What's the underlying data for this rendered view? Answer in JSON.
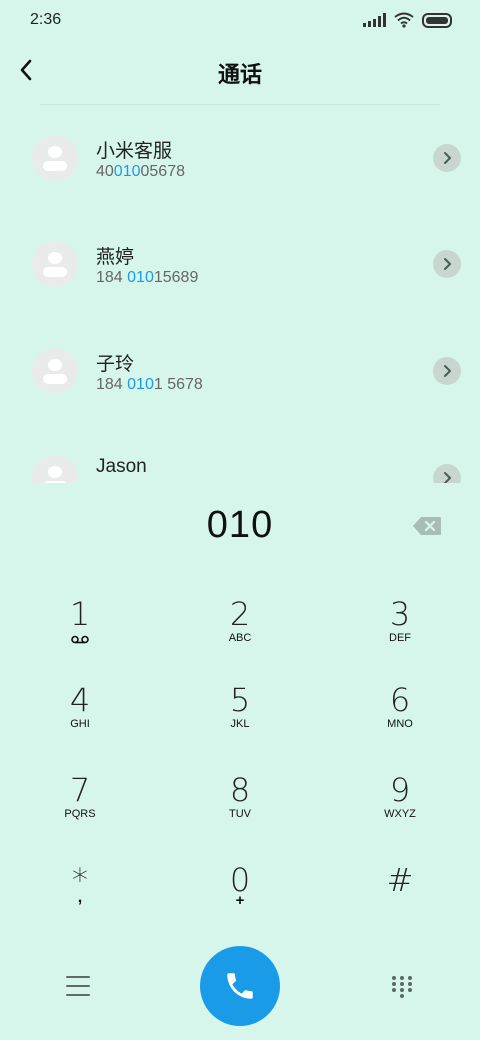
{
  "status": {
    "time": "2:36"
  },
  "header": {
    "title": "通话"
  },
  "contacts": [
    {
      "name": "小米客服",
      "num_pre": "40",
      "num_hl": "010",
      "num_post": "05678"
    },
    {
      "name": "燕婷",
      "num_pre": "184 ",
      "num_hl": "010",
      "num_post": "15689"
    },
    {
      "name": "子玲",
      "num_pre": "184 ",
      "num_hl": "010",
      "num_post": "1 5678"
    },
    {
      "name": "Jason",
      "num_pre": "",
      "num_hl": "",
      "num_post": ""
    }
  ],
  "dial": {
    "number": "010"
  },
  "keys": [
    {
      "num": "1",
      "sub": "voicemail"
    },
    {
      "num": "2",
      "sub": "ABC"
    },
    {
      "num": "3",
      "sub": "DEF"
    },
    {
      "num": "4",
      "sub": "GHI"
    },
    {
      "num": "5",
      "sub": "JKL"
    },
    {
      "num": "6",
      "sub": "MNO"
    },
    {
      "num": "7",
      "sub": "PQRS"
    },
    {
      "num": "8",
      "sub": "TUV"
    },
    {
      "num": "9",
      "sub": "WXYZ"
    },
    {
      "num": "*",
      "sub": ","
    },
    {
      "num": "0",
      "sub": "+"
    },
    {
      "num": "#",
      "sub": ""
    }
  ],
  "colors": {
    "background": "#d6f6ec",
    "accent": "#1a9be8"
  },
  "icons": [
    "back-icon",
    "chevron-right-icon",
    "backspace-icon",
    "menu-icon",
    "phone-icon",
    "dialpad-icon"
  ]
}
